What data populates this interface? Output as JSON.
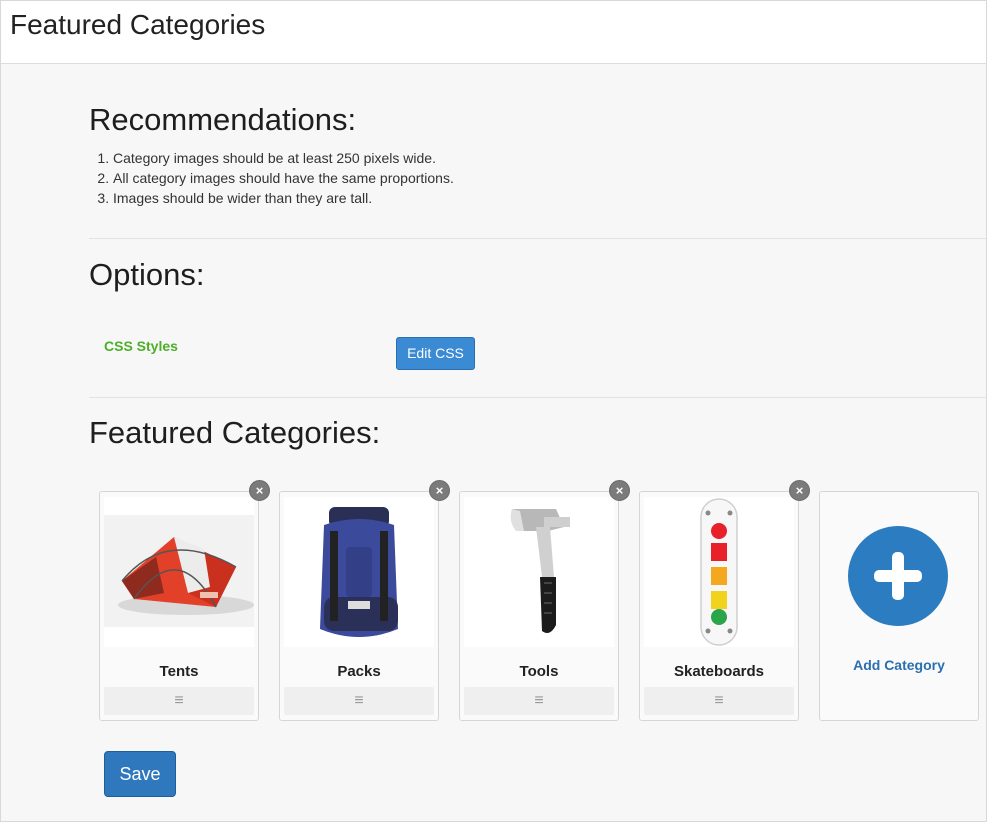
{
  "header": {
    "title": "Featured Categories"
  },
  "recommendations": {
    "title": "Recommendations:",
    "items": [
      "Category images should be at least 250 pixels wide.",
      "All category images should have the same proportions.",
      "Images should be wider than they are tall."
    ]
  },
  "options": {
    "title": "Options:",
    "css_label": "CSS Styles",
    "edit_css_label": "Edit CSS"
  },
  "featured": {
    "title": "Featured Categories:",
    "categories": [
      {
        "name": "Tents",
        "image": "tent-image"
      },
      {
        "name": "Packs",
        "image": "backpack-image"
      },
      {
        "name": "Tools",
        "image": "axe-image"
      },
      {
        "name": "Skateboards",
        "image": "skateboard-image"
      }
    ],
    "add_label": "Add Category",
    "remove_symbol": "×",
    "handle_symbol": "≡"
  },
  "actions": {
    "save_label": "Save"
  },
  "colors": {
    "accent": "#2f78bd",
    "css_label": "#4caf2a",
    "add_circle": "#2c7cc1"
  }
}
